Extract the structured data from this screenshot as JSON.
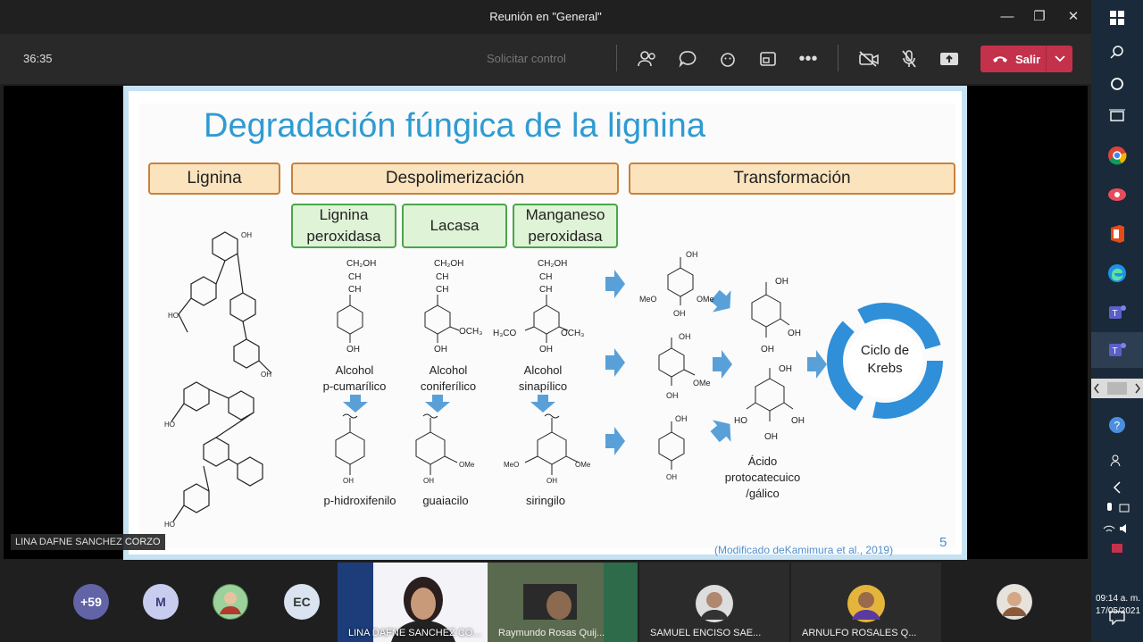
{
  "window": {
    "title": "Reunión en \"General\""
  },
  "toolbar": {
    "timer": "36:35",
    "request_control": "Solicitar control",
    "leave_label": "Salir"
  },
  "slide": {
    "title": "Degradación fúngica de la lignina",
    "headers": {
      "lignina": "Lignina",
      "despolimerizacion": "Despolimerización",
      "transformacion": "Transformación"
    },
    "enzymes": {
      "lip": "Lignina peroxidasa",
      "lacasa": "Lacasa",
      "mnp": "Manganeso peroxidasa"
    },
    "alcohols": {
      "a1_1": "Alcohol",
      "a1_2": "p-cumarílico",
      "a2_1": "Alcohol",
      "a2_2": "coniferílico",
      "a3_1": "Alcohol",
      "a3_2": "sinapílico"
    },
    "units": {
      "u1": "p-hidroxifenilo",
      "u2": "guaiacilo",
      "u3": "siringilo"
    },
    "chem": {
      "ch2oh": "CH₂OH",
      "ch": "CH",
      "oh": "OH",
      "och3": "OCH₃",
      "h3co": "H₃CO",
      "meo": "MeO",
      "ome": "OMe",
      "ho": "HO"
    },
    "acid": {
      "line1": "Ácido",
      "line2": "protocatecuico",
      "line3": "/gálico"
    },
    "cycle": {
      "line1": "Ciclo de",
      "line2": "Krebs"
    },
    "citation": "(Modificado deKamimura et al., 2019)",
    "page": "5"
  },
  "presenter_label": "LINA DAFNE SANCHEZ CORZO",
  "participants": {
    "overflow": "+59",
    "m": "M",
    "ec": "EC",
    "tile1": "LINA DAFNE SANCHEZ CO...",
    "tile2": "Raymundo Rosas Quij...",
    "tile3": "SAMUEL ENCISO SAE...",
    "tile4": "ARNULFO ROSALES Q..."
  },
  "clock": {
    "time": "09:14 a. m.",
    "date": "17/05/2021"
  },
  "colors": {
    "leave": "#c4314b",
    "accent": "#2f9bd2",
    "header_fill": "#fbe3bd",
    "enzyme_fill": "#dff3d6"
  }
}
